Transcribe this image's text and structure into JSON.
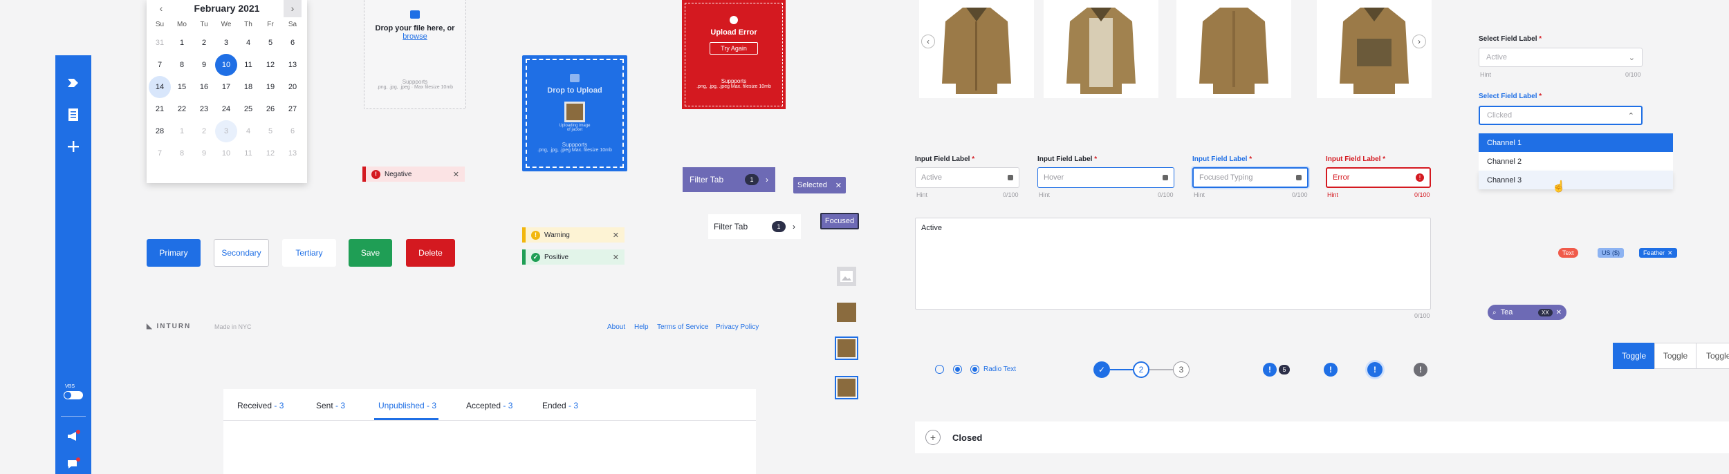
{
  "sidebar": {
    "toggle_label": "VBS"
  },
  "calendar": {
    "month": "February 2021",
    "weekdays": [
      "Su",
      "Mo",
      "Tu",
      "We",
      "Th",
      "Fr",
      "Sa"
    ],
    "weeks": [
      [
        "31",
        "1",
        "2",
        "3",
        "4",
        "5",
        "6"
      ],
      [
        "7",
        "8",
        "9",
        "10",
        "11",
        "12",
        "13"
      ],
      [
        "14",
        "15",
        "16",
        "17",
        "18",
        "19",
        "20"
      ],
      [
        "21",
        "22",
        "23",
        "24",
        "25",
        "26",
        "27"
      ],
      [
        "28",
        "1",
        "2",
        "3",
        "4",
        "5",
        "6"
      ],
      [
        "7",
        "8",
        "9",
        "10",
        "11",
        "12",
        "13"
      ]
    ],
    "selected": "10"
  },
  "upload": {
    "drop_text": "Drop your file here, or",
    "browse": "browse",
    "supports": "Suppports",
    "supports_detail": ".png, .jpg, .jpeg · Max filesize 10mb",
    "drop_to_upload": "Drop to Upload",
    "preview_caption": "Uploading image of jacket",
    "supports_detail2": ".png, .jpg, .jpeg Max. filesize 10mb",
    "error_title": "Upload Error",
    "try_again": "Try Again",
    "supports_detail3": ".png, .jpg, .jpeg Max. filesize 10mb"
  },
  "alerts": {
    "negative": "Negative",
    "warning": "Warning",
    "positive": "Positive"
  },
  "filter": {
    "tab1": "Filter Tab",
    "count1": "1",
    "tab2": "Filter Tab",
    "count2": "1",
    "selected": "Selected",
    "focused": "Focused"
  },
  "buttons": {
    "primary": "Primary",
    "secondary": "Secondary",
    "tertiary": "Tertiary",
    "save": "Save",
    "delete": "Delete"
  },
  "footer": {
    "brand": "INTURN",
    "made": "Made in NYC",
    "links": [
      "About",
      "Help",
      "Terms of Service",
      "Privacy Policy"
    ]
  },
  "tabs": [
    {
      "label": "Received",
      "count": "3"
    },
    {
      "label": "Sent",
      "count": "3"
    },
    {
      "label": "Unpublished",
      "count": "3"
    },
    {
      "label": "Accepted",
      "count": "3"
    },
    {
      "label": "Ended",
      "count": "3"
    }
  ],
  "inputs": {
    "label": "Input Field Label",
    "req": "*",
    "fields": [
      {
        "value": "Active",
        "hint": "Hint",
        "count": "0/100"
      },
      {
        "value": "Hover",
        "hint": "Hint",
        "count": "0/100"
      },
      {
        "value": "Focused Typing",
        "hint": "Hint",
        "count": "0/100"
      },
      {
        "value": "Error",
        "hint": "Hint",
        "count": "0/100"
      }
    ],
    "textarea": "Active",
    "textarea_count": "0/100"
  },
  "select": {
    "label": "Select Field Label",
    "req": "*",
    "active": "Active",
    "hint": "Hint",
    "count": "0/100",
    "clicked": "Clicked",
    "options": [
      "Channel 1",
      "Channel 2",
      "Channel 3"
    ]
  },
  "chips": {
    "text": "Text",
    "us": "US ($)",
    "feather": "Feather"
  },
  "search": {
    "value": "Tea",
    "badge": "XX"
  },
  "radio": {
    "label": "Radio Text"
  },
  "steps": [
    "2",
    "3"
  ],
  "badges": {
    "count": "5"
  },
  "toggles": [
    "Toggle",
    "Toggle",
    "Toggle"
  ],
  "accordion": {
    "label": "Closed"
  },
  "colors": {
    "accent": "#1f6fe5",
    "danger": "#d41920",
    "success": "#1f9e55",
    "warning": "#f2b70f",
    "purple": "#6d6ab5"
  }
}
